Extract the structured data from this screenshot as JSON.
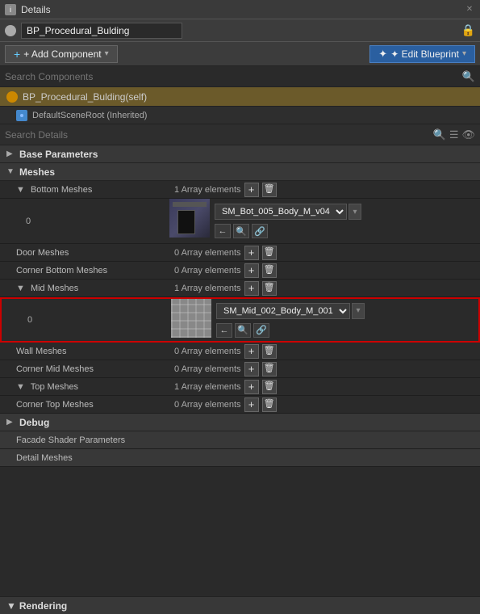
{
  "titleBar": {
    "icon": "i",
    "label": "Details",
    "closeIcon": "✕"
  },
  "bpNameRow": {
    "name": "BP_Procedural_Bulding",
    "lockIcon": "🔒"
  },
  "toolbar": {
    "addLabel": "+ Add Component",
    "addArrow": "▾",
    "editLabel": "✦ Edit Blueprint",
    "editArrow": "▾"
  },
  "searchComponents": {
    "placeholder": "Search Components",
    "searchIcon": "🔍"
  },
  "selfRow": {
    "label": "BP_Procedural_Bulding(self)"
  },
  "sceneRootRow": {
    "label": "DefaultSceneRoot (Inherited)"
  },
  "searchDetails": {
    "placeholder": "Search Details",
    "searchIcon": "🔍",
    "listIcon": "☰",
    "eyeIcon": "👁"
  },
  "properties": {
    "baseParameters": {
      "label": "Base Parameters",
      "collapsed": false
    },
    "meshes": {
      "label": "Meshes",
      "collapsed": false
    },
    "bottomMeshes": {
      "label": "Bottom Meshes",
      "count": "1 Array elements",
      "index": "0",
      "assetName": "SM_Bot_005_Body_M_v04",
      "thumbType": "bot"
    },
    "doorMeshes": {
      "label": "Door Meshes",
      "count": "0 Array elements"
    },
    "cornerBottomMeshes": {
      "label": "Corner Bottom Meshes",
      "count": "0 Array elements"
    },
    "midMeshes": {
      "label": "Mid Meshes",
      "count": "1 Array elements",
      "index": "0",
      "assetName": "SM_Mid_002_Body_M_001",
      "thumbType": "mid",
      "highlighted": true
    },
    "wallMeshes": {
      "label": "Wall Meshes",
      "count": "0 Array elements"
    },
    "cornerMidMeshes": {
      "label": "Corner Mid Meshes",
      "count": "0 Array elements"
    },
    "topMeshes": {
      "label": "Top Meshes",
      "count": "1 Array elements"
    },
    "cornerTopMeshes": {
      "label": "Corner Top Meshes",
      "count": "0 Array elements"
    },
    "debug": {
      "label": "Debug"
    },
    "facadeShaderParameters": {
      "label": "Facade Shader Parameters"
    },
    "detailMeshes": {
      "label": "Detail Meshes"
    },
    "rendering": {
      "label": "Rendering"
    }
  },
  "icons": {
    "collapse": "▼",
    "expand": "▶",
    "add": "+",
    "delete": "🗑",
    "back": "←",
    "search": "🔍",
    "link": "🔗"
  }
}
